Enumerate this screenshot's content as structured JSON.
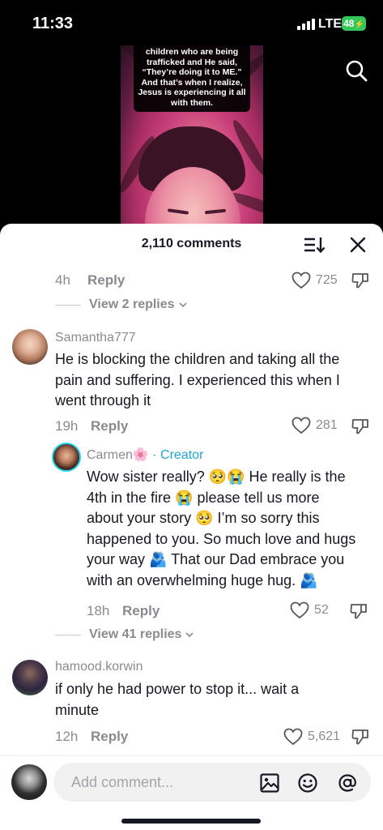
{
  "status_bar": {
    "time": "11:33",
    "network": "LTE",
    "battery": "48"
  },
  "video": {
    "caption_lines": [
      "children who are being",
      "trafficked and He said,",
      "“They’re doing it to ME.”",
      "And that’s when I realize,",
      "Jesus is experiencing it all",
      "with them."
    ]
  },
  "icons": {
    "search": "search-icon",
    "sort": "sort-icon",
    "close": "close-icon",
    "like": "heart-icon",
    "dislike": "thumbs-down-icon",
    "image": "image-icon",
    "emoji": "emoji-icon",
    "mention": "at-sign-icon",
    "chevron": "chevron-down-icon"
  },
  "panel": {
    "title": "2,110 comments",
    "top_comment": {
      "time": "4h",
      "reply": "Reply",
      "likes": "725",
      "view_replies": "View 2 replies"
    },
    "comments": [
      {
        "username": "Samantha777",
        "lines": [
          "He is blocking the children and taking all the",
          "pain and suffering. I experienced this when I",
          "went through it"
        ],
        "time": "19h",
        "reply": "Reply",
        "likes": "281",
        "reply_item": {
          "username": "Carmen🌸",
          "separator": " · ",
          "badge": "Creator",
          "lines": [
            "Wow sister really? 🥺😭 He really is the",
            "4th in the fire 😭 please tell us more",
            "about your story 🥺 I’m so sorry this",
            "happened to you. So much love and hugs",
            "your way 🫂 That our Dad embrace you",
            "with an overwhelming huge hug. 🫂"
          ],
          "time": "18h",
          "reply": "Reply",
          "likes": "52"
        },
        "view_replies": "View 41 replies"
      },
      {
        "username": "hamood.korwin",
        "lines": [
          "if only he had power to stop it... wait a",
          "minute"
        ],
        "time": "12h",
        "reply": "Reply",
        "likes": "5,621"
      }
    ]
  },
  "input": {
    "placeholder": "Add comment..."
  },
  "colors": {
    "creator": "#20a4d8",
    "battery": "#34c759",
    "text": "#161823",
    "muted": "#8a8b91"
  }
}
